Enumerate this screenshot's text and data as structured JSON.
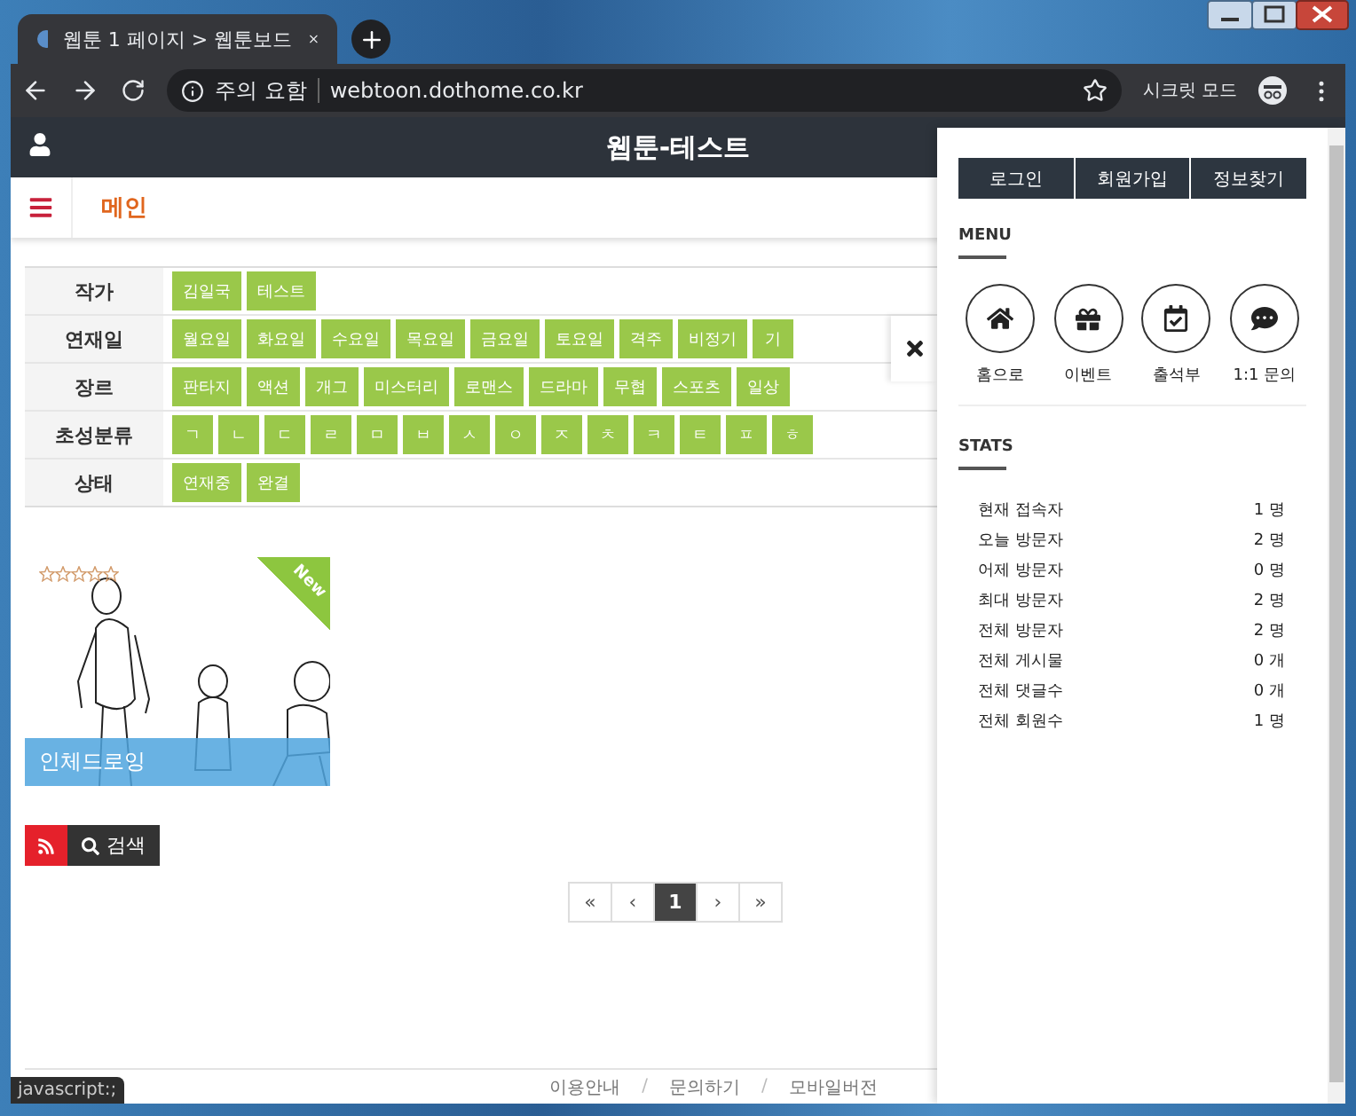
{
  "browser": {
    "tabs": [
      {
        "title": "웹툰 1 페이지 > 웹툰보드",
        "selected": true
      }
    ],
    "security_label": "주의 요함",
    "url": "webtoon.dothome.co.kr",
    "profile_label": "시크릿 모드"
  },
  "site": {
    "title": "웹툰-테스트",
    "nav_label": "메인"
  },
  "filters": [
    {
      "label": "작가",
      "options": [
        "김일국",
        "테스트"
      ]
    },
    {
      "label": "연재일",
      "options": [
        "월요일",
        "화요일",
        "수요일",
        "목요일",
        "금요일",
        "토요일",
        "격주",
        "비정기",
        "기"
      ]
    },
    {
      "label": "장르",
      "options": [
        "판타지",
        "액션",
        "개그",
        "미스터리",
        "로맨스",
        "드라마",
        "무협",
        "스포츠",
        "일상"
      ]
    },
    {
      "label": "초성분류",
      "options": [
        "ㄱ",
        "ㄴ",
        "ㄷ",
        "ㄹ",
        "ㅁ",
        "ㅂ",
        "ㅅ",
        "ㅇ",
        "ㅈ",
        "ㅊ",
        "ㅋ",
        "ㅌ",
        "ㅍ",
        "ㅎ"
      ]
    },
    {
      "label": "상태",
      "options": [
        "연재중",
        "완결"
      ]
    }
  ],
  "works": [
    {
      "title": "인체드로잉",
      "stars": 0,
      "badge": "New"
    }
  ],
  "actions": {
    "search_label": "검색"
  },
  "pagination": {
    "first": "«",
    "prev": "‹",
    "pages": [
      {
        "label": "1",
        "selected": true
      }
    ],
    "next": "›",
    "last": "»"
  },
  "panel": {
    "auth_buttons": [
      "로그인",
      "회원가입",
      "정보찾기"
    ],
    "menu_title": "MENU",
    "menu": [
      {
        "kind": "home",
        "label": "홈으로"
      },
      {
        "kind": "gift",
        "label": "이벤트"
      },
      {
        "kind": "calendar",
        "label": "출석부"
      },
      {
        "kind": "chat",
        "label": "1:1 문의"
      }
    ],
    "stats_title": "STATS",
    "stats": [
      {
        "label": "현재 접속자",
        "value": "1 명"
      },
      {
        "label": "오늘 방문자",
        "value": "2 명"
      },
      {
        "label": "어제 방문자",
        "value": "0 명"
      },
      {
        "label": "최대 방문자",
        "value": "2 명"
      },
      {
        "label": "전체 방문자",
        "value": "2 명"
      },
      {
        "label": "전체 게시물",
        "value": "0 개"
      },
      {
        "label": "전체 댓글수",
        "value": "0 개"
      },
      {
        "label": "전체 회원수",
        "value": "1 명"
      }
    ]
  },
  "footer": {
    "links": [
      "이용안내",
      "문의하기",
      "모바일버전"
    ],
    "separators": [
      "/",
      "/"
    ]
  },
  "status_text": "javascript:;"
}
